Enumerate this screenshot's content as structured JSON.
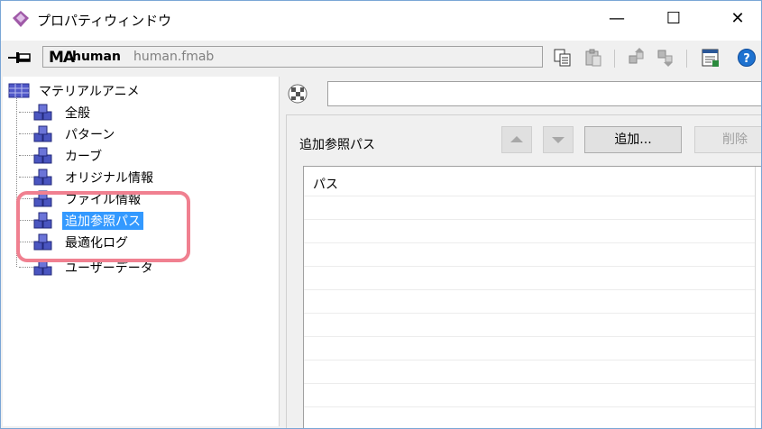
{
  "window": {
    "title": "プロパティウィンドウ",
    "min_glyph": "—",
    "max_glyph": "☐",
    "close_glyph": "✕"
  },
  "toolbar": {
    "logo_text": "MA",
    "object_name": "human",
    "file_name": "human.fmab"
  },
  "tree": {
    "root_label": "マテリアルアニメ",
    "items": [
      {
        "label": "全般"
      },
      {
        "label": "パターン"
      },
      {
        "label": "カーブ"
      },
      {
        "label": "オリジナル情報"
      },
      {
        "label": "ファイル情報"
      },
      {
        "label": "追加参照パス",
        "selected": true
      },
      {
        "label": "最適化ログ"
      },
      {
        "label": "ユーザーデータ"
      }
    ]
  },
  "panel": {
    "top_input_value": "",
    "section_label": "追加参照パス",
    "add_button_label": "追加...",
    "delete_button_label": "削除",
    "list_header": "パス"
  },
  "colors": {
    "highlight_box": "#f08090",
    "selection": "#3399ff",
    "window_border": "#7aa6d6"
  },
  "icons": [
    "app-icon",
    "pin-icon",
    "copy-icon",
    "paste-icon",
    "node-up-icon",
    "node-down-icon",
    "window-icon",
    "help-icon",
    "checker-icon",
    "node-icon",
    "arrow-up-icon",
    "arrow-down-icon"
  ]
}
